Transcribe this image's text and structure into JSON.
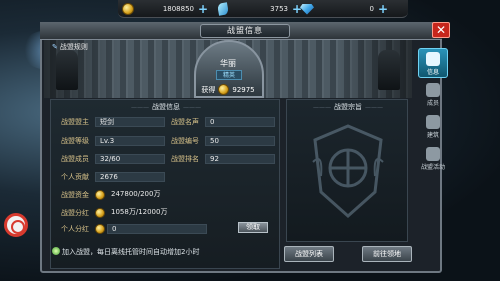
{
  "resources": {
    "gold": "1808850",
    "crystal": "3753",
    "diamond": "0"
  },
  "window": {
    "title": "战盟信息",
    "close_icon": "close-icon"
  },
  "banner": {
    "rules_tab": "战盟规则",
    "guild_name": "华丽",
    "guild_tag": "精英",
    "obtain_label": "获得",
    "obtain_value": "92975"
  },
  "info": {
    "title": "战盟信息",
    "rows": {
      "leader_label": "战盟盟主",
      "leader_value": "短剑",
      "fame_label": "战盟名声",
      "fame_value": "0",
      "level_label": "战盟等级",
      "level_value": "Lv.3",
      "number_label": "战盟编号",
      "number_value": "50",
      "members_label": "战盟成员",
      "members_value": "32/60",
      "rank_label": "战盟排名",
      "rank_value": "92",
      "contrib_label": "个人贡献",
      "contrib_value": "2676",
      "funds_label": "战盟资金",
      "funds_value": "247800/200万",
      "dividend_label": "战盟分红",
      "dividend_value": "1058万/12000万",
      "personal_label": "个人分红",
      "personal_value": "0"
    },
    "claim_button": "领取"
  },
  "purpose": {
    "title": "战盟宗旨"
  },
  "notice": "加入战盟，每日离线托管时间自动增加2小时",
  "buttons": {
    "guild_list": "战盟列表",
    "goto_territory": "前往领地"
  },
  "side_tabs": [
    {
      "label": "信息",
      "icon": "info-icon"
    },
    {
      "label": "成员",
      "icon": "members-icon"
    },
    {
      "label": "建筑",
      "icon": "building-icon"
    },
    {
      "label": "战盟活动",
      "icon": "activity-icon"
    }
  ],
  "colors": {
    "accent": "#2a93b9",
    "label_gold": "#d7c28a",
    "close_red": "#c7261c"
  }
}
